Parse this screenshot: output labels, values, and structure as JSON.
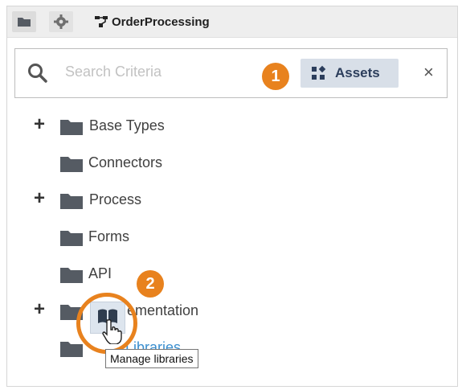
{
  "header": {
    "app_name": "OrderProcessing",
    "folder_icon": "folder-icon",
    "settings_icon": "gear-icon",
    "app_icon": "flow-icon"
  },
  "search": {
    "placeholder": "Search Criteria",
    "assets_label": "Assets",
    "close_label": "×"
  },
  "badges": {
    "one": "1",
    "two": "2"
  },
  "tree": {
    "items": [
      {
        "label": "Base Types",
        "expandable": true
      },
      {
        "label": "Connectors",
        "expandable": false
      },
      {
        "label": "Process",
        "expandable": true
      },
      {
        "label": "Forms",
        "expandable": false
      },
      {
        "label": "API",
        "expandable": false
      },
      {
        "label": "Implementation",
        "visible_text": "ementation",
        "expandable": true
      },
      {
        "label": "Libraries",
        "visible_text": "Libraries",
        "expandable": false
      }
    ],
    "expander": "+"
  },
  "tooltip": {
    "text": "Manage libraries"
  },
  "colors": {
    "accent": "#e8821e",
    "link": "#3b8fcf",
    "folder": "#555b63"
  }
}
